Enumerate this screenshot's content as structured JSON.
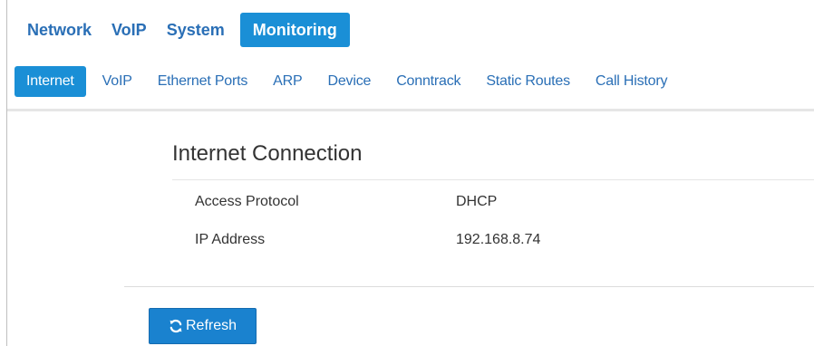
{
  "topnav": {
    "items": [
      {
        "label": "Network"
      },
      {
        "label": "VoIP"
      },
      {
        "label": "System"
      },
      {
        "label": "Monitoring",
        "active": true
      }
    ]
  },
  "subnav": {
    "items": [
      {
        "label": "Internet",
        "active": true
      },
      {
        "label": "VoIP"
      },
      {
        "label": "Ethernet Ports"
      },
      {
        "label": "ARP"
      },
      {
        "label": "Device"
      },
      {
        "label": "Conntrack"
      },
      {
        "label": "Static Routes"
      },
      {
        "label": "Call History"
      }
    ]
  },
  "section": {
    "title": "Internet Connection",
    "rows": [
      {
        "key": "Access Protocol",
        "value": "DHCP"
      },
      {
        "key": "IP Address",
        "value": "192.168.8.74"
      }
    ]
  },
  "actions": {
    "refresh_label": "Refresh",
    "refresh_icon": "refresh-icon"
  },
  "colors": {
    "accent": "#1a8fd6",
    "link": "#2a6fb6",
    "button": "#1a82cf"
  }
}
